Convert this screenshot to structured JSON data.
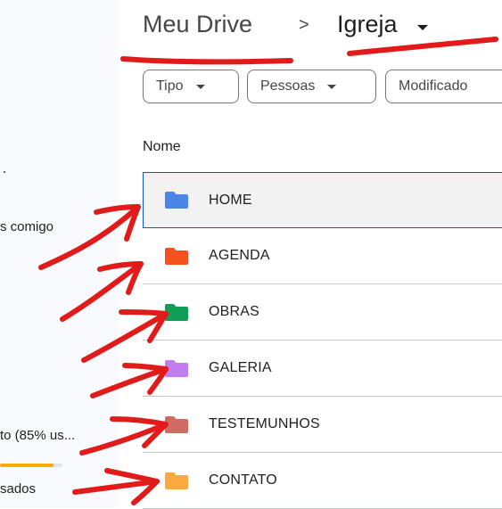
{
  "sidebar": {
    "shared_fragment": "s comigo",
    "storage_fragment": "to (85% us...",
    "storage_used_fraction": 0.85,
    "used_fragment": "sados"
  },
  "breadcrumb": {
    "root": "Meu Drive",
    "separator": ">",
    "current": "Igreja"
  },
  "filters": [
    {
      "label": "Tipo"
    },
    {
      "label": "Pessoas"
    },
    {
      "label": "Modificado"
    }
  ],
  "list": {
    "column_name": "Nome",
    "rows": [
      {
        "name": "HOME",
        "color": "#4a86e8"
      },
      {
        "name": "AGENDA",
        "color": "#f4511e"
      },
      {
        "name": "OBRAS",
        "color": "#0f9d58"
      },
      {
        "name": "GALERIA",
        "color": "#c27bf0"
      },
      {
        "name": "TESTEMUNHOS",
        "color": "#d06b64"
      },
      {
        "name": "CONTATO",
        "color": "#fbaa41"
      }
    ]
  },
  "colors": {
    "annotation": "#e11a1a",
    "selection_border": "#0b57d0",
    "storage_bar": "#f9ab00"
  }
}
